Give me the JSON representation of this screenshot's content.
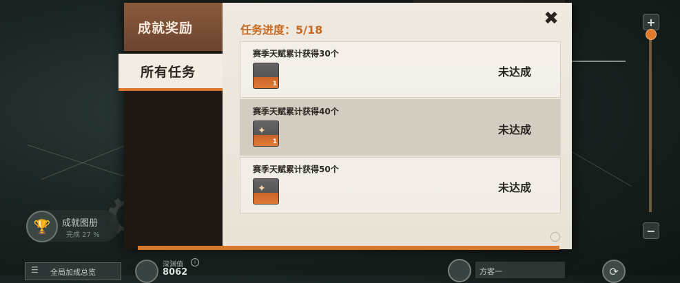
{
  "modal": {
    "sidebar_header": "成就奖励",
    "tab_all": "所有任务",
    "progress": "任务进度：5/18",
    "close_symbol": "✖"
  },
  "tasks": [
    {
      "title": "赛季天赋累计获得30个",
      "item_count": "1",
      "status": "未达成"
    },
    {
      "title": "赛季天赋累计获得40个",
      "item_count": "1",
      "status": "未达成"
    },
    {
      "title": "赛季天赋累计获得50个",
      "item_count": "",
      "status": "未达成"
    }
  ],
  "background": {
    "album_title": "成就图册",
    "album_sub": "完成 27 %",
    "bonus_button": "全局加成总览",
    "abyss_label": "深渊值",
    "abyss_value": "8062",
    "player_name": "方客一"
  },
  "icons": {
    "trophy": "trophy-icon",
    "list": "list-icon",
    "refresh": "refresh-icon",
    "close": "close-icon",
    "plus": "plus-icon",
    "minus": "minus-icon"
  },
  "colors": {
    "accent": "#d9772c",
    "progress_text": "#c46a22",
    "sidebar_header": "#8c5a3c",
    "content_bg": "#efe9df"
  }
}
